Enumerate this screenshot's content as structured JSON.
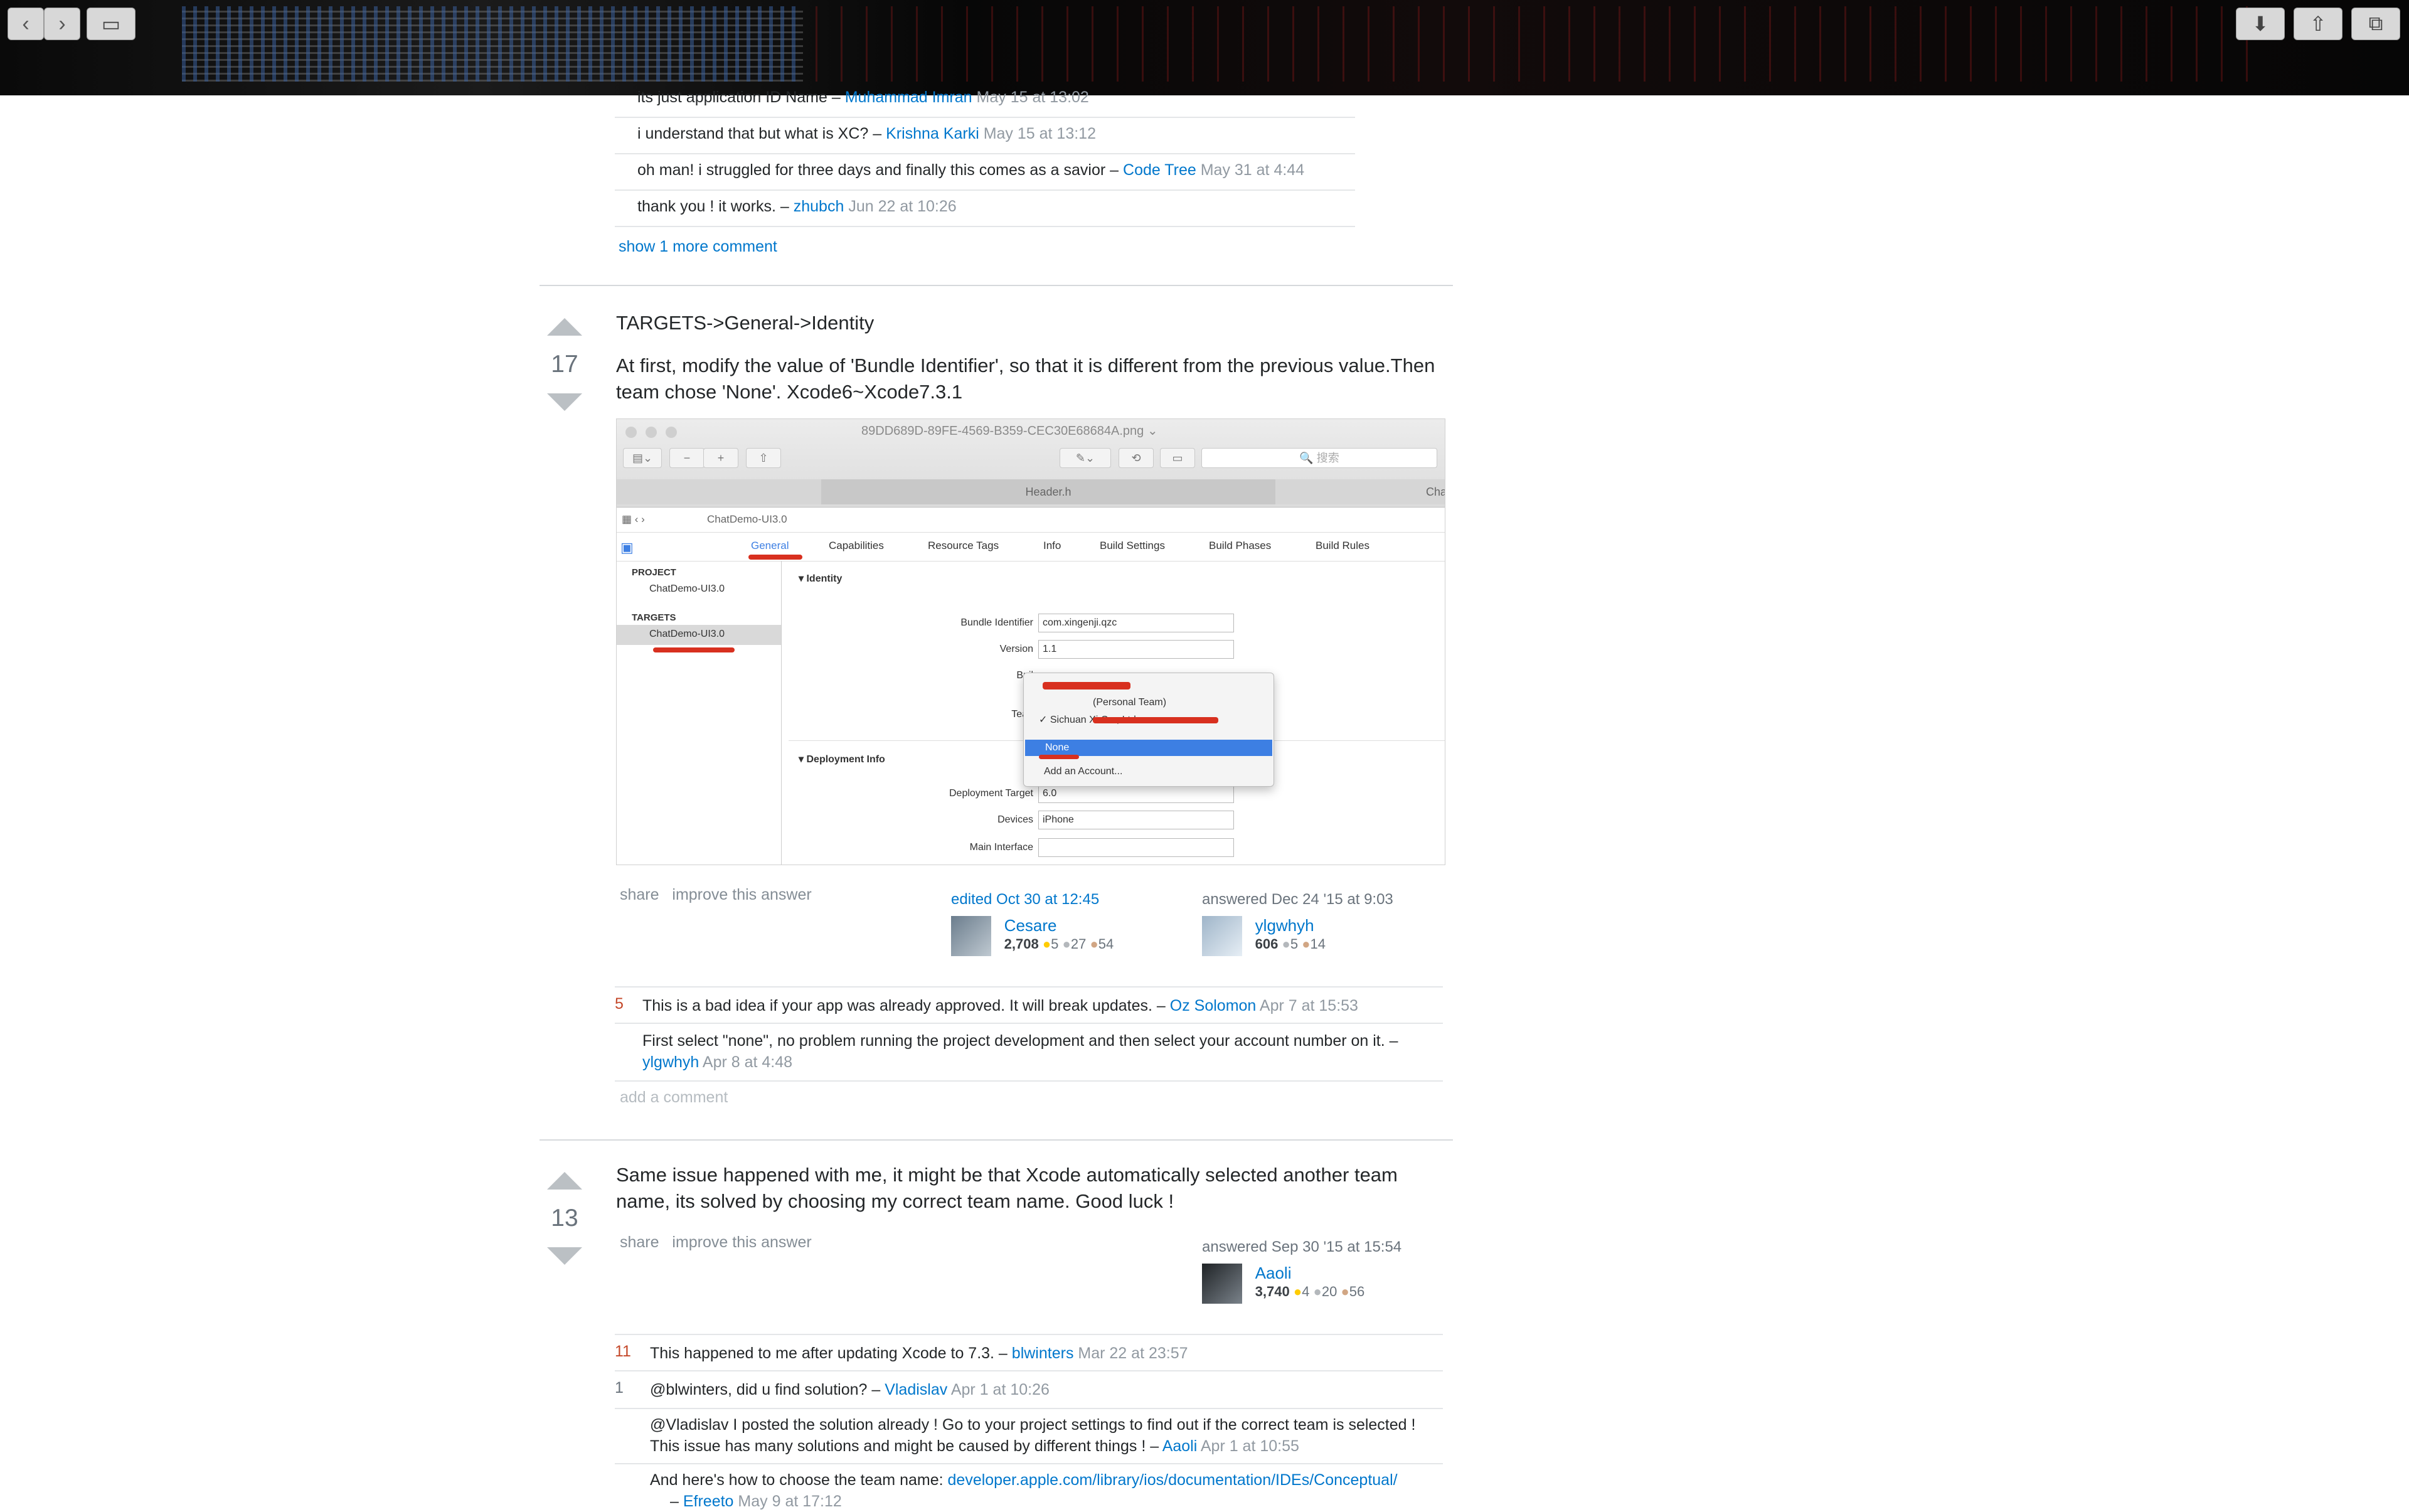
{
  "browser": {
    "back_glyph": "‹",
    "forward_glyph": "›",
    "sidebar_glyph": "▭",
    "download_glyph": "⬇",
    "share_glyph": "⇧",
    "tabs_glyph": "⧉"
  },
  "top_comments": [
    {
      "text": "its just application ID Name –",
      "user": "Muhammad Imran",
      "time": "May 15 at 13:02"
    },
    {
      "text": "i understand that but what is XC? –",
      "user": "Krishna Karki",
      "time": "May 15 at 13:12"
    },
    {
      "text": "oh man! i struggled for three days and finally this comes as a savior –",
      "user": "Code Tree",
      "time": "May 31 at 4:44"
    },
    {
      "text": "thank you ! it works. –",
      "user": "zhubch",
      "time": "Jun 22 at 10:26"
    }
  ],
  "show_more": "show 1 more comment",
  "answer1": {
    "votes": "17",
    "line1": "TARGETS->General->Identity",
    "para": "At first, modify the value of 'Bundle Identifier', so that it is different from the previous value.Then team chose 'None'. Xcode6~Xcode7.3.1",
    "embed": {
      "file_title": "89DD689D-89FE-4569-B359-CEC30E68684A.png ⌄",
      "search_placeholder": "🔍 搜索",
      "tab_header": "Header.h",
      "tab_right": "Cha",
      "breadcrumb": "ChatDemo-UI3.0",
      "tabs": [
        "General",
        "Capabilities",
        "Resource Tags",
        "Info",
        "Build Settings",
        "Build Phases",
        "Build Rules"
      ],
      "project_label": "PROJECT",
      "project_item": "ChatDemo-UI3.0",
      "targets_label": "TARGETS",
      "target_item": "ChatDemo-UI3.0",
      "identity": "Identity",
      "bundle_label": "Bundle Identifier",
      "bundle_value": "com.xingenji.qzc",
      "version_label": "Version",
      "version_value": "1.1",
      "build_label": "Buil",
      "team_label": "Tean",
      "popup_personal": "(Personal Team)",
      "popup_company": "✓ Sichuan Xi          Co., Ltd.",
      "popup_none": "None",
      "popup_add": "Add an Account...",
      "deploy": "Deployment Info",
      "deploy_target_label": "Deployment Target",
      "deploy_target_value": "6.0",
      "devices_label": "Devices",
      "devices_value": "iPhone",
      "main_interface_label": "Main Interface"
    },
    "share": "share",
    "improve": "improve this answer",
    "edited": "edited Oct 30 at 12:45",
    "editor": "Cesare",
    "editor_rep": "2,708",
    "editor_gold": "5",
    "editor_silver": "27",
    "editor_bronze": "54",
    "answered": "answered Dec 24 '15 at 9:03",
    "author": "ylgwhyh",
    "author_rep": "606",
    "author_silver": "5",
    "author_bronze": "14",
    "comments": [
      {
        "score": "5",
        "text": "This is a bad idea if your app was already approved. It will break updates. –",
        "user": "Oz Solomon",
        "time": "Apr 7 at 15:53"
      },
      {
        "score": "",
        "text": "First select \"none\", no problem running the project development and then select your account number on it. –",
        "user": "ylgwhyh",
        "time": "Apr 8 at 4:48"
      }
    ],
    "add_comment": "add a comment"
  },
  "answer2": {
    "votes": "13",
    "para": "Same issue happened with me, it might be that Xcode automatically selected another team name, its solved by choosing my correct team name. Good luck !",
    "share": "share",
    "improve": "improve this answer",
    "answered": "answered Sep 30 '15 at 15:54",
    "author": "Aaoli",
    "author_rep": "3,740",
    "author_gold": "4",
    "author_silver": "20",
    "author_bronze": "56",
    "comments": [
      {
        "score": "11",
        "text": "This happened to me after updating Xcode to 7.3. –",
        "user": "blwinters",
        "time": "Mar 22 at 23:57"
      },
      {
        "score": "1",
        "text": "@blwinters, did u find solution? –",
        "user": "Vladislav",
        "time": "Apr 1 at 10:26"
      },
      {
        "score": "",
        "text": "@Vladislav I posted the solution already ! Go to your project settings to find out if the correct team is selected ! This issue has many solutions and might be caused by different things ! –",
        "user": "Aaoli",
        "time": "Apr 1 at 10:55"
      },
      {
        "score": "",
        "text": "And here's how to choose the team name:",
        "link": "developer.apple.com/library/ios/documentation/IDEs/Conceptual/",
        "user": "Efreeto",
        "time": "May 9 at 17:12"
      }
    ]
  }
}
